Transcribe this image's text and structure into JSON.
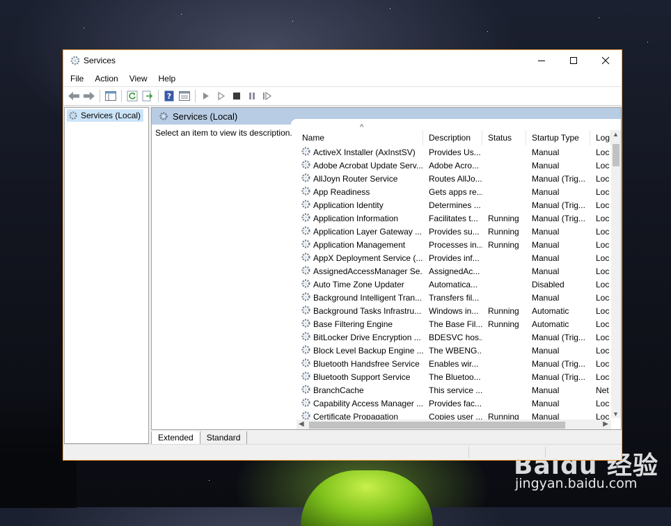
{
  "window": {
    "title": "Services"
  },
  "menu": [
    "File",
    "Action",
    "View",
    "Help"
  ],
  "tree": {
    "root_label": "Services (Local)"
  },
  "detail": {
    "header": "Services (Local)",
    "description_prompt": "Select an item to view its description.",
    "columns": [
      "Name",
      "Description",
      "Status",
      "Startup Type",
      "Log"
    ],
    "services": [
      {
        "name": "ActiveX Installer (AxInstSV)",
        "description": "Provides Us...",
        "status": "",
        "startup": "Manual",
        "log": "Loc"
      },
      {
        "name": "Adobe Acrobat Update Serv...",
        "description": "Adobe Acro...",
        "status": "",
        "startup": "Manual",
        "log": "Loc"
      },
      {
        "name": "AllJoyn Router Service",
        "description": "Routes AllJo...",
        "status": "",
        "startup": "Manual (Trig...",
        "log": "Loc"
      },
      {
        "name": "App Readiness",
        "description": "Gets apps re...",
        "status": "",
        "startup": "Manual",
        "log": "Loc"
      },
      {
        "name": "Application Identity",
        "description": "Determines ...",
        "status": "",
        "startup": "Manual (Trig...",
        "log": "Loc"
      },
      {
        "name": "Application Information",
        "description": "Facilitates t...",
        "status": "Running",
        "startup": "Manual (Trig...",
        "log": "Loc"
      },
      {
        "name": "Application Layer Gateway ...",
        "description": "Provides su...",
        "status": "Running",
        "startup": "Manual",
        "log": "Loc"
      },
      {
        "name": "Application Management",
        "description": "Processes in...",
        "status": "Running",
        "startup": "Manual",
        "log": "Loc"
      },
      {
        "name": "AppX Deployment Service (...",
        "description": "Provides inf...",
        "status": "",
        "startup": "Manual",
        "log": "Loc"
      },
      {
        "name": "AssignedAccessManager Se...",
        "description": "AssignedAc...",
        "status": "",
        "startup": "Manual",
        "log": "Loc"
      },
      {
        "name": "Auto Time Zone Updater",
        "description": "Automatica...",
        "status": "",
        "startup": "Disabled",
        "log": "Loc"
      },
      {
        "name": "Background Intelligent Tran...",
        "description": "Transfers fil...",
        "status": "",
        "startup": "Manual",
        "log": "Loc"
      },
      {
        "name": "Background Tasks Infrastru...",
        "description": "Windows in...",
        "status": "Running",
        "startup": "Automatic",
        "log": "Loc"
      },
      {
        "name": "Base Filtering Engine",
        "description": "The Base Fil...",
        "status": "Running",
        "startup": "Automatic",
        "log": "Loc"
      },
      {
        "name": "BitLocker Drive Encryption ...",
        "description": "BDESVC hos...",
        "status": "",
        "startup": "Manual (Trig...",
        "log": "Loc"
      },
      {
        "name": "Block Level Backup Engine ...",
        "description": "The WBENG...",
        "status": "",
        "startup": "Manual",
        "log": "Loc"
      },
      {
        "name": "Bluetooth Handsfree Service",
        "description": "Enables wir...",
        "status": "",
        "startup": "Manual (Trig...",
        "log": "Loc"
      },
      {
        "name": "Bluetooth Support Service",
        "description": "The Bluetoo...",
        "status": "",
        "startup": "Manual (Trig...",
        "log": "Loc"
      },
      {
        "name": "BranchCache",
        "description": "This service ...",
        "status": "",
        "startup": "Manual",
        "log": "Net"
      },
      {
        "name": "Capability Access Manager ...",
        "description": "Provides fac...",
        "status": "",
        "startup": "Manual",
        "log": "Loc"
      },
      {
        "name": "Certificate Propagation",
        "description": "Copies user ...",
        "status": "Running",
        "startup": "Manual",
        "log": "Loc"
      }
    ]
  },
  "tabs": [
    "Extended",
    "Standard"
  ],
  "watermark": {
    "logo": "Baidu 经验",
    "url": "jingyan.baidu.com"
  },
  "colors": {
    "accent_border": "#f0a040",
    "header_band": "#b8cce4",
    "tree_selection": "#cce4f7"
  }
}
